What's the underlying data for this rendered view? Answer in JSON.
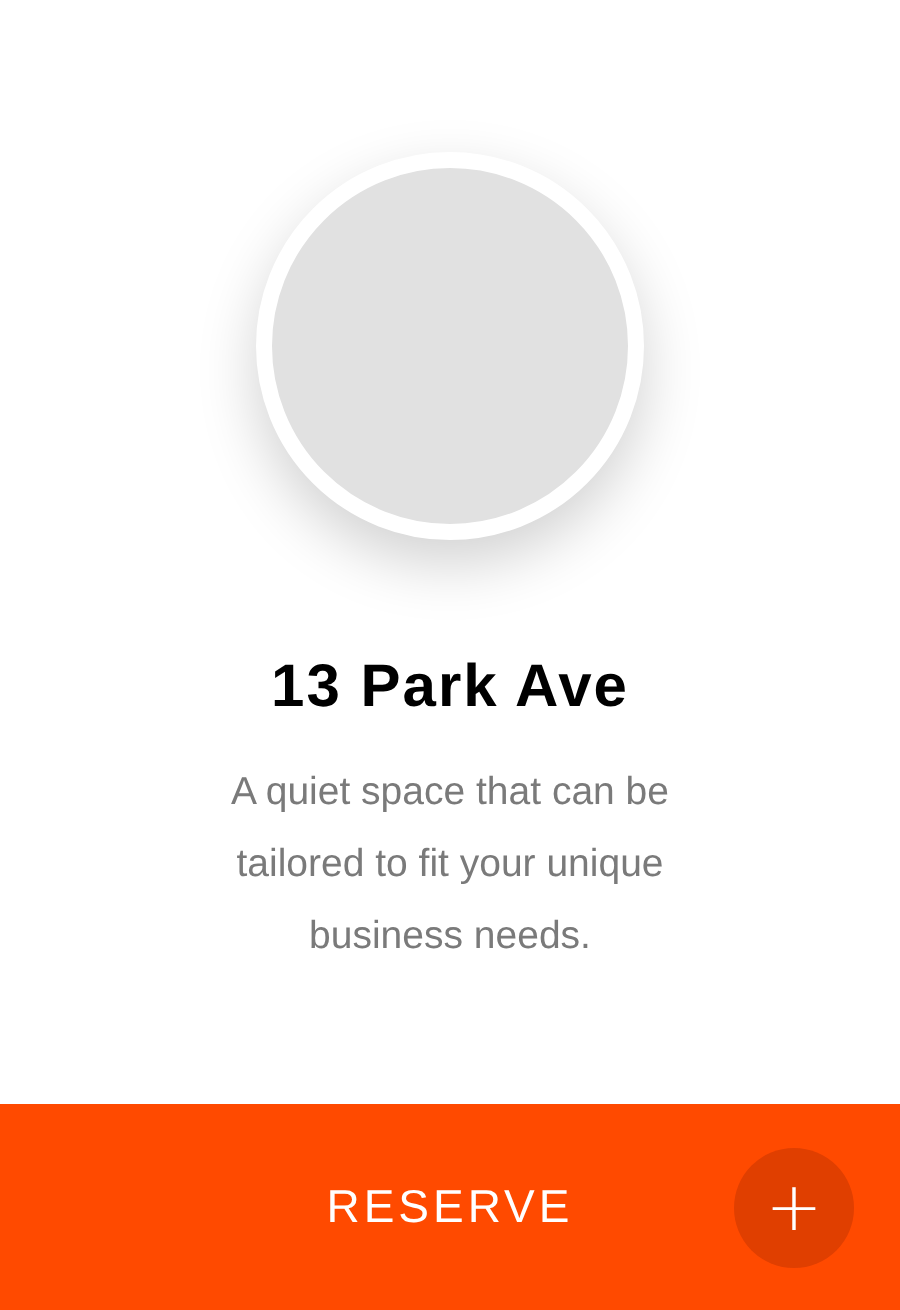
{
  "card": {
    "title": "13 Park Ave",
    "description": "A quiet space that can be tailored to fit your unique business needs."
  },
  "action_bar": {
    "label": "RESERVE",
    "add_button": "+"
  }
}
